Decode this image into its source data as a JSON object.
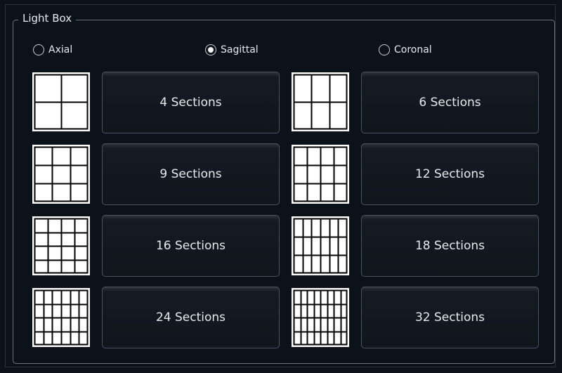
{
  "group": {
    "title": "Light Box"
  },
  "orientation": {
    "options": [
      {
        "label": "Axial",
        "checked": false
      },
      {
        "label": "Sagittal",
        "checked": true
      },
      {
        "label": "Coronal",
        "checked": false
      }
    ]
  },
  "layouts": [
    {
      "label": "4 Sections",
      "rows": 2,
      "cols": 2
    },
    {
      "label": "6 Sections",
      "rows": 2,
      "cols": 3
    },
    {
      "label": "9 Sections",
      "rows": 3,
      "cols": 3
    },
    {
      "label": "12 Sections",
      "rows": 3,
      "cols": 4
    },
    {
      "label": "16 Sections",
      "rows": 4,
      "cols": 4
    },
    {
      "label": "18 Sections",
      "rows": 3,
      "cols": 6
    },
    {
      "label": "24 Sections",
      "rows": 4,
      "cols": 6
    },
    {
      "label": "32 Sections",
      "rows": 4,
      "cols": 8
    }
  ],
  "colors": {
    "background": "#0c121a",
    "text": "#e6eaee",
    "thumbnail": "#ffffff",
    "grid_lines": "#000000"
  }
}
